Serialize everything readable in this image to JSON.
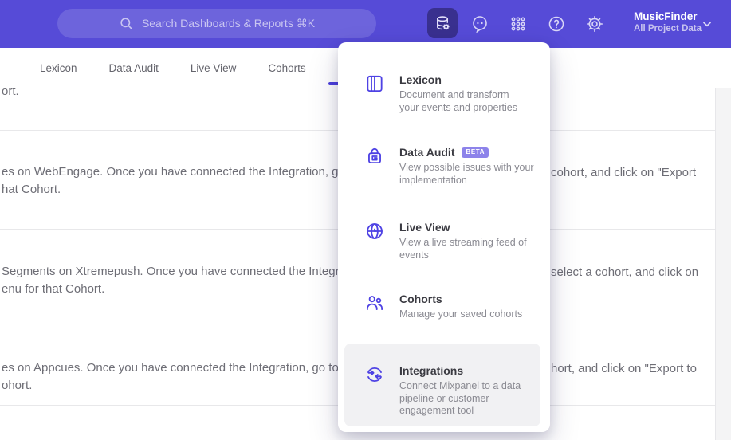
{
  "header": {
    "search_placeholder": "Search Dashboards & Reports ⌘K",
    "project_name": "MusicFinder",
    "project_subtitle": "All Project Data",
    "icon_names": [
      "search-icon",
      "data-management-icon",
      "feedback-icon",
      "apps-grid-icon",
      "help-icon",
      "settings-icon",
      "chevron-down-icon"
    ]
  },
  "nav": {
    "tabs": [
      {
        "label": "Lexicon"
      },
      {
        "label": "Data Audit"
      },
      {
        "label": "Live View"
      },
      {
        "label": "Cohorts"
      }
    ]
  },
  "menu": {
    "items": [
      {
        "title": "Lexicon",
        "icon": "book-icon",
        "desc_lines": [
          "Document and transform",
          "your events and properties"
        ]
      },
      {
        "title": "Data Audit",
        "badge": "BETA",
        "icon": "audit-lock-icon",
        "desc_lines": [
          "View possible issues with your",
          "implementation"
        ]
      },
      {
        "title": "Live View",
        "icon": "globe-icon",
        "desc_lines": [
          "View a live streaming feed of",
          "events"
        ]
      },
      {
        "title": "Cohorts",
        "icon": "users-icon",
        "desc_lines": [
          "Manage your saved cohorts"
        ]
      },
      {
        "title": "Integrations",
        "icon": "sync-arrows-icon",
        "desc_lines": [
          "Connect Mixpanel to a data",
          "pipeline or customer",
          "engagement tool"
        ],
        "highlighted": true
      }
    ]
  },
  "content": {
    "row0": "ort.",
    "rows": [
      {
        "left_line1": "es on WebEngage. Once you have connected the Integration, go to the",
        "left_line2": "hat Cohort.",
        "right_line1": "cohort, and click on \"Export"
      },
      {
        "left_line1": "Segments on Xtremepush. Once you have connected the Integration,",
        "left_line2": "enu for that Cohort.",
        "right_line1": "select a cohort, and click on"
      },
      {
        "left_line1": "es on Appcues. Once you have connected the Integration, go to the M",
        "left_line2": "ohort.",
        "right_line1": "hort, and click on \"Export to"
      }
    ]
  },
  "colors": {
    "header_bg": "#564bd7",
    "active_icon_bg": "#39308f",
    "accent_purple": "#4e42e4",
    "badge_bg": "#8d83ea",
    "tab_text": "#64646c",
    "body_text": "#6e6e76",
    "highlight_bg": "#f1f1f3"
  }
}
